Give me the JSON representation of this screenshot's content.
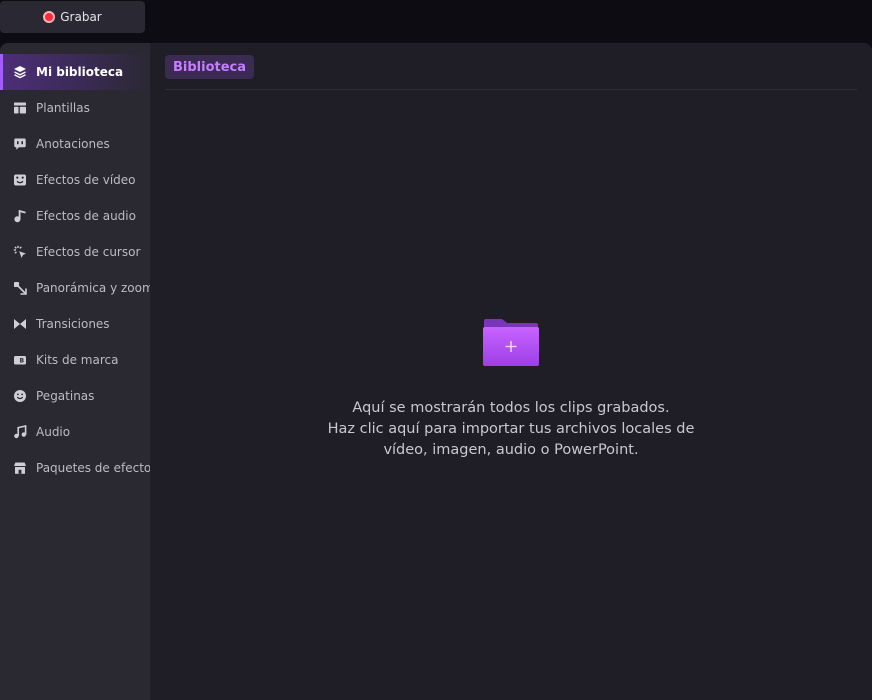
{
  "toolbar": {
    "record_label": "Grabar",
    "record_color": "#ff2b3a"
  },
  "sidebar": {
    "items": [
      {
        "label": "Mi biblioteca",
        "icon": "layers-icon",
        "active": true
      },
      {
        "label": "Plantillas",
        "icon": "template-icon"
      },
      {
        "label": "Anotaciones",
        "icon": "annotation-icon"
      },
      {
        "label": "Efectos de vídeo",
        "icon": "video-effects-icon"
      },
      {
        "label": "Efectos de audio",
        "icon": "music-note-icon"
      },
      {
        "label": "Efectos de cursor",
        "icon": "cursor-click-icon"
      },
      {
        "label": "Panorámica y zoom",
        "icon": "pan-zoom-icon"
      },
      {
        "label": "Transiciones",
        "icon": "transition-icon"
      },
      {
        "label": "Kits de marca",
        "icon": "brand-kit-icon"
      },
      {
        "label": "Pegatinas",
        "icon": "sticker-icon"
      },
      {
        "label": "Audio",
        "icon": "audio-icon"
      },
      {
        "label": "Paquetes de efectos",
        "icon": "store-icon"
      }
    ]
  },
  "main": {
    "tab_label": "Biblioteca",
    "accent_color": "#c77dff",
    "empty_state": {
      "icon": "folder-add-icon",
      "line1": "Aquí se mostrarán todos los clips grabados.",
      "line2": "Haz clic aquí para importar tus archivos locales de",
      "line3": "vídeo, imagen, audio o PowerPoint."
    }
  }
}
